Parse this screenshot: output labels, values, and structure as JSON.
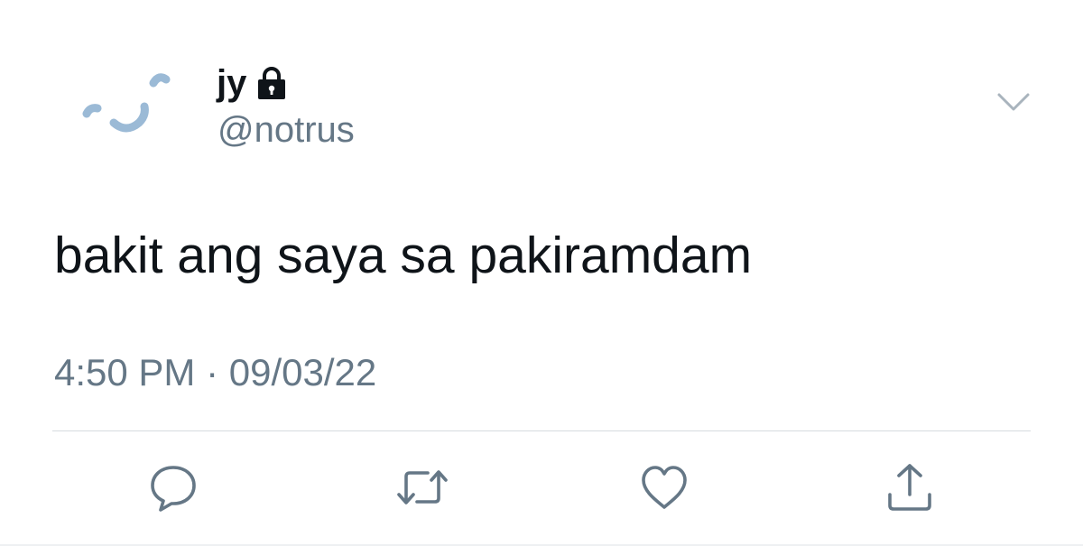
{
  "user": {
    "display_name": "jy",
    "handle": "@notrus",
    "protected": true,
    "avatar_color": "#9bbad6"
  },
  "tweet": {
    "text": "bakit ang saya sa pakiramdam",
    "meta": "4:50 PM · 09/03/22"
  },
  "actions": [
    {
      "name": "reply",
      "icon": "speech-bubble-icon"
    },
    {
      "name": "retweet",
      "icon": "retweet-icon"
    },
    {
      "name": "like",
      "icon": "heart-icon"
    },
    {
      "name": "share",
      "icon": "share-icon"
    }
  ],
  "colors": {
    "text_primary": "#0f1419",
    "text_secondary": "#657786",
    "icon": "#657786",
    "divider": "#d6dbdf"
  }
}
